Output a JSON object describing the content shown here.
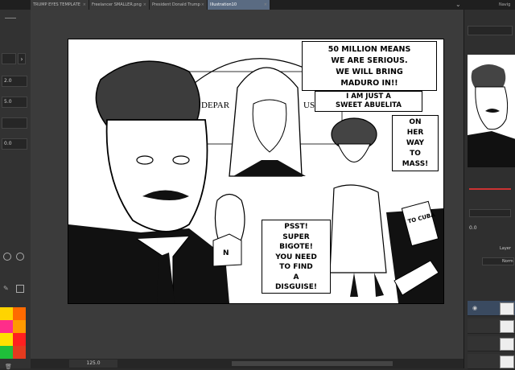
{
  "tabs": [
    {
      "label": "TRUMP EYES TEMPLATE"
    },
    {
      "label": "Freelancer SMALLER.png"
    },
    {
      "label": "President Donald Trump"
    },
    {
      "label": "Illustration10"
    }
  ],
  "left_panel": {
    "values": [
      "2.0",
      "5.0",
      "0.0"
    ]
  },
  "status": {
    "zoom": "125.0"
  },
  "right_panel": {
    "layer_tab": "Layer",
    "blend_mode": "Norm",
    "opacity": "0.0"
  },
  "artwork": {
    "bubble_1": [
      "50 MILLION MEANS",
      "WE ARE SERIOUS.",
      "WE WILL BRING",
      "MADURO IN!!"
    ],
    "bubble_2": [
      "I AM JUST A",
      "SWEET ABUELITA"
    ],
    "bubble_3": [
      "ON",
      "HER",
      "WAY",
      "TO",
      "MASS!"
    ],
    "bubble_4": [
      "PSST!",
      "SUPER",
      "BIGOTE!",
      "YOU NEED",
      "TO FIND",
      "A",
      "DISGUISE!"
    ],
    "building_text": "DEPAR",
    "building_text_2": "US",
    "sign_text": "TO CUBA",
    "shirt_text": "N"
  },
  "colors": {
    "swatches": [
      "#ffd400",
      "#ff6a00",
      "#ff2d8a",
      "#ff9900",
      "#ffe100",
      "#ff2020",
      "#1fbf3a",
      "#e33b1f"
    ]
  }
}
